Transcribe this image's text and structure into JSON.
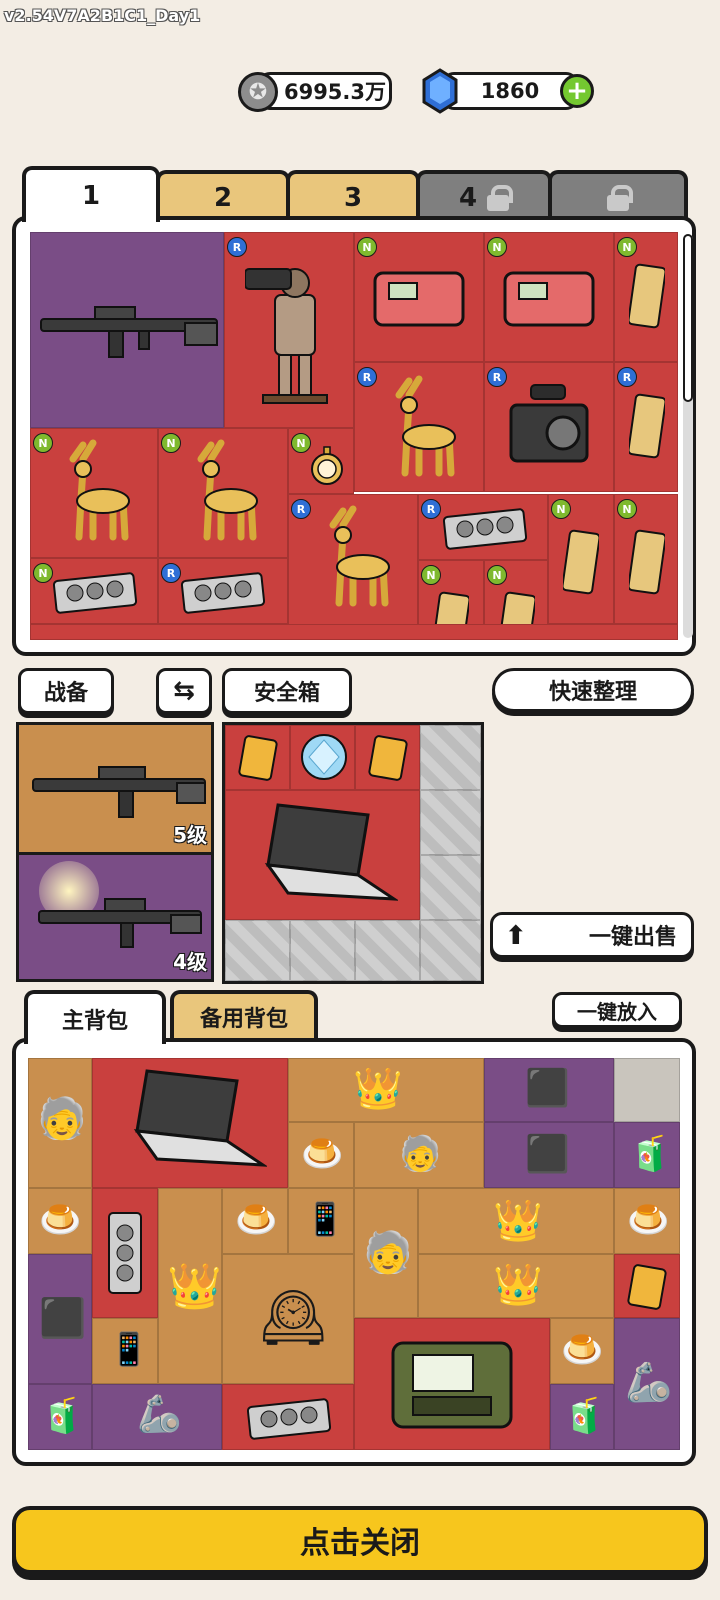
{
  "version": {
    "main": "v2.54",
    "build": "V7A2B1C1_Day1"
  },
  "currency": {
    "coins": {
      "icon": "silver-coin-icon",
      "value": "6995.3万"
    },
    "gems": {
      "icon": "blue-gem-icon",
      "value": "1860",
      "add_icon": "plus-icon"
    }
  },
  "storage_tabs": [
    {
      "label": "1",
      "locked": false,
      "active": true
    },
    {
      "label": "2",
      "locked": false
    },
    {
      "label": "3",
      "locked": false
    },
    {
      "label": "4",
      "locked": true
    },
    {
      "label": "",
      "locked": true
    }
  ],
  "storage_items": [
    {
      "icon": "assault-rifle-icon",
      "badge": "",
      "color": "purple"
    },
    {
      "icon": "terracotta-warrior-statue-icon",
      "badge": "R",
      "color": "red"
    },
    {
      "icon": "electronic-device-icon",
      "badge": "N",
      "color": "red"
    },
    {
      "icon": "electronic-device-icon",
      "badge": "N",
      "color": "red"
    },
    {
      "icon": "gold-bar-icon",
      "badge": "N",
      "color": "red"
    },
    {
      "icon": "golden-deer-statue-icon",
      "badge": "R",
      "color": "red"
    },
    {
      "icon": "camera-icon",
      "badge": "R",
      "color": "red"
    },
    {
      "icon": "gold-bar-icon",
      "badge": "R",
      "color": "red"
    },
    {
      "icon": "golden-deer-statue-icon",
      "badge": "N",
      "color": "red"
    },
    {
      "icon": "golden-deer-statue-icon",
      "badge": "N",
      "color": "red"
    },
    {
      "icon": "pocket-watch-icon",
      "badge": "N",
      "color": "red"
    },
    {
      "icon": "golden-deer-statue-icon",
      "badge": "R",
      "color": "red"
    },
    {
      "icon": "graphics-card-icon",
      "badge": "R",
      "color": "red"
    },
    {
      "icon": "gold-bar-icon",
      "badge": "N",
      "color": "red"
    },
    {
      "icon": "gold-bar-icon",
      "badge": "N",
      "color": "red"
    },
    {
      "icon": "graphics-card-icon",
      "badge": "N",
      "color": "red"
    },
    {
      "icon": "graphics-card-icon",
      "badge": "R",
      "color": "red"
    },
    {
      "icon": "gold-bar-icon",
      "badge": "N",
      "color": "red"
    },
    {
      "icon": "gold-bar-icon",
      "badge": "N",
      "color": "red"
    }
  ],
  "buttons": {
    "loadout": "战备",
    "swap_icon": "swap-arrows-icon",
    "safe_box": "安全箱",
    "quick_sort": "快速整理",
    "sell_all": "一键出售",
    "sell_icon": "upload-arrow-icon",
    "put_all": "一键放入",
    "close": "点击关闭"
  },
  "loadout": [
    {
      "icon": "assault-rifle-icon",
      "level": "5级",
      "color": "orange"
    },
    {
      "icon": "submachine-gun-icon",
      "level": "4级",
      "color": "purple"
    }
  ],
  "safe_box_items": [
    {
      "icon": "gold-card-icon"
    },
    {
      "icon": "diamond-icon"
    },
    {
      "icon": "gold-card-icon"
    },
    {
      "icon": "laptop-icon"
    }
  ],
  "bag_tabs": [
    {
      "label": "主背包",
      "active": true
    },
    {
      "label": "备用背包",
      "active": false
    }
  ],
  "bag_items": [
    "einstein-figurine-icon",
    "laptop-icon",
    "golden-crown-icon",
    "game-console-icon",
    "game-console-icon",
    "juice-box-icon",
    "pudding-icon",
    "einstein-figurine-icon",
    "pudding-icon",
    "graphics-card-icon",
    "pudding-icon",
    "smartphone-icon",
    "golden-crown-icon",
    "pudding-icon",
    "game-console-icon",
    "golden-crown-icon",
    "einstein-figurine-icon",
    "antique-clock-icon",
    "golden-crown-icon",
    "gold-card-icon",
    "smartphone-icon",
    "military-radio-case-icon",
    "pudding-icon",
    "robot-claw-icon",
    "juice-box-icon",
    "robot-claw-icon",
    "graphics-card-icon",
    "juice-box-icon"
  ],
  "colors": {
    "accent": "#f7c61d",
    "rarity_red": "#c9403e",
    "rarity_purple": "#7a4d86",
    "rarity_orange": "#c98f4e",
    "badge_N": "#7fb92e",
    "badge_R": "#2f6fd6",
    "tab_yellow": "#e9c67c"
  }
}
